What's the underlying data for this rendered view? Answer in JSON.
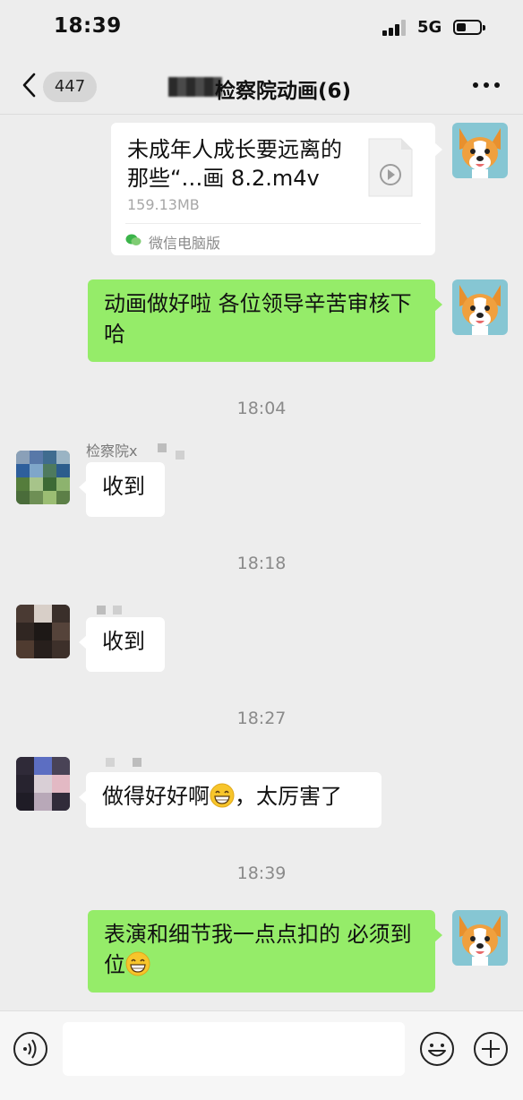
{
  "status_bar": {
    "time": "18:39",
    "network": "5G"
  },
  "nav": {
    "back_badge": "447",
    "title": "检察院动画(6)"
  },
  "messages": {
    "file": {
      "name": "未成年人成长要远离的那些“…画 8.2.m4v",
      "size": "159.13MB",
      "source": "微信电脑版"
    },
    "m1": "动画做好啦  各位领导辛苦审核下哈",
    "t1": "18:04",
    "s2_name": "检察院x",
    "m2": "收到",
    "t2": "18:18",
    "m3": "收到",
    "t3": "18:27",
    "m4_a": "做得好好啊",
    "m4_b": "，太厉害了",
    "t4": "18:39",
    "m5_a": "表演和细节我一点点扣的  必须到位"
  },
  "icons": {
    "back": "chevron-left-icon",
    "more": "more-dots-icon",
    "voice": "voice-icon",
    "emoji": "emoji-icon",
    "add": "plus-icon",
    "video": "video-file-icon"
  },
  "colors": {
    "my_bubble": "#95ec69",
    "their_bubble": "#ffffff",
    "background": "#ededed"
  }
}
